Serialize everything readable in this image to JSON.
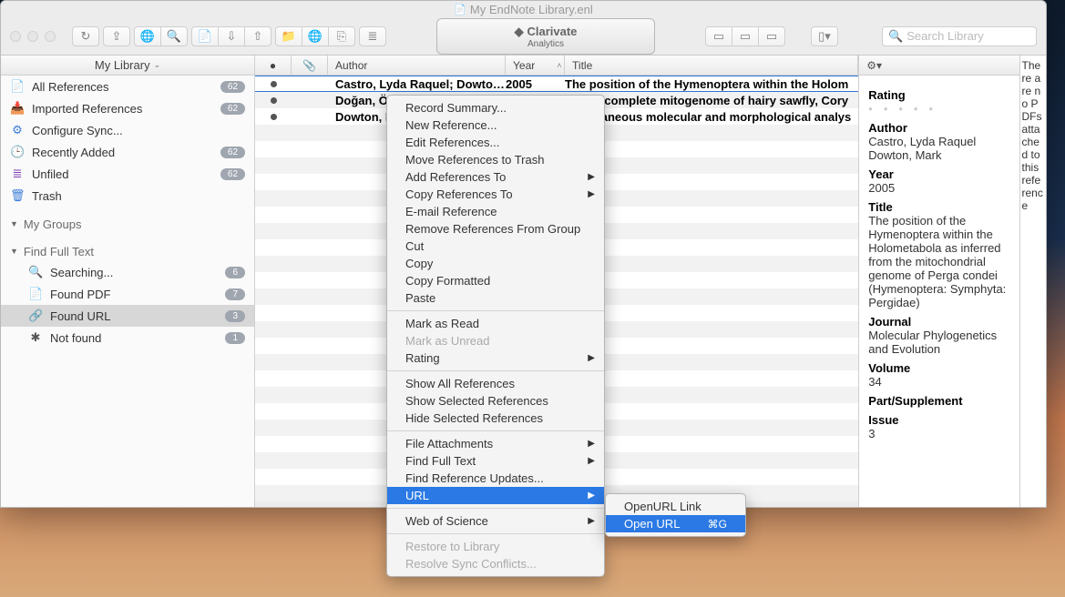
{
  "titlebar": {
    "filename": "My EndNote Library.enl"
  },
  "toolbar": {
    "brand": {
      "name": "Clarivate",
      "sub": "Analytics"
    },
    "search_placeholder": "Search Library"
  },
  "sidebar": {
    "header": "My Library",
    "items": [
      {
        "icon": "📄",
        "icon_color": "#3b7dd8",
        "label": "All References",
        "badge": "62"
      },
      {
        "icon": "📥",
        "icon_color": "#3b7dd8",
        "label": "Imported References",
        "badge": "62"
      },
      {
        "icon": "⚙",
        "icon_color": "#3b7dd8",
        "label": "Configure Sync..."
      },
      {
        "icon": "🕒",
        "icon_color": "#3b7dd8",
        "label": "Recently Added",
        "badge": "62"
      },
      {
        "icon": "≣",
        "icon_color": "#7e3fb5",
        "label": "Unfiled",
        "badge": "62"
      },
      {
        "icon": "🗑",
        "icon_color": "#3b7dd8",
        "label": "Trash"
      }
    ],
    "groups": {
      "my_groups": "My Groups",
      "find_full_text": "Find Full Text",
      "fft_items": [
        {
          "icon": "🔍",
          "label": "Searching...",
          "badge": "6"
        },
        {
          "icon": "📄",
          "label": "Found PDF",
          "badge": "7"
        },
        {
          "icon": "🔗",
          "label": "Found URL",
          "badge": "3",
          "selected": true
        },
        {
          "icon": "✱",
          "icon_color": "#555",
          "label": "Not found",
          "badge": "1"
        }
      ]
    }
  },
  "list": {
    "headers": {
      "author": "Author",
      "year": "Year",
      "title": "Title"
    },
    "rows": [
      {
        "author": "Castro, Lyda Raquel; Dowto…",
        "year": "2005",
        "title": "The position of the Hymenoptera within the Holom"
      },
      {
        "author": "Doğan, Özgül; Korkmaz, Erta…",
        "year": "",
        "title": "Nearly complete mitogenome of hairy sawfly, Cory"
      },
      {
        "author": "Dowton, Mark; Austin, Andre…",
        "year": "",
        "title": "Simultaneous molecular and morphological analys"
      }
    ]
  },
  "preview": {
    "rating_label": "Rating",
    "author_label": "Author",
    "author_val": "Castro, Lyda Raquel\nDowton, Mark",
    "year_label": "Year",
    "year_val": "2005",
    "title_label": "Title",
    "title_val": "The position of the Hymenoptera within the Holometabola as inferred from the mitochondrial genome of Perga condei (Hymenoptera: Symphyta: Pergidae)",
    "journal_label": "Journal",
    "journal_val": "Molecular Phylogenetics and Evolution",
    "volume_label": "Volume",
    "volume_val": "34",
    "part_label": "Part/Supplement",
    "issue_label": "Issue",
    "issue_val": "3"
  },
  "sidepanel_text": "There are no PDFs attached to this reference",
  "ctx": {
    "items": [
      "Record Summary...",
      "New Reference...",
      "Edit References...",
      "Move References to Trash",
      "Add References To",
      "Copy References To",
      "E-mail Reference",
      "Remove References From Group",
      "Cut",
      "Copy",
      "Copy Formatted",
      "Paste",
      "Mark as Read",
      "Mark as Unread",
      "Rating",
      "Show All References",
      "Show Selected References",
      "Hide Selected References",
      "File Attachments",
      "Find Full Text",
      "Find Reference Updates...",
      "URL",
      "Web of Science",
      "Restore to Library",
      "Resolve Sync Conflicts..."
    ],
    "submenu": {
      "openurl_link": "OpenURL Link",
      "open_url": "Open URL",
      "shortcut": "⌘G"
    }
  }
}
